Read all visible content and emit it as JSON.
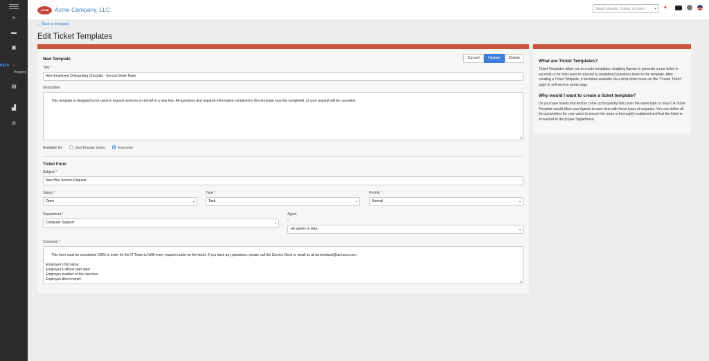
{
  "sidebar": {
    "items": [
      {
        "label": "Create",
        "icon": "plus-icon"
      },
      {
        "label": "Tickets",
        "icon": "ticket-icon"
      },
      {
        "label": "Assets",
        "icon": "assets-icon"
      },
      {
        "label": "BETA",
        "icon": ""
      },
      {
        "label": "Projects",
        "icon": "projects-icon"
      },
      {
        "label": "Knowledge Base",
        "icon": "book-icon"
      },
      {
        "label": "Reports",
        "icon": "reports-icon"
      },
      {
        "label": "Settings",
        "icon": "gear-icon"
      }
    ]
  },
  "header": {
    "logo_text": "ACME",
    "company": "Acme Company, LLC",
    "search_placeholder": "Search Assets, Tickets, or Users"
  },
  "page": {
    "back_link": "← Back to templates",
    "title": "Edit Ticket Templates"
  },
  "form": {
    "section_title": "New Template",
    "buttons": {
      "cancel": "Cancel",
      "update": "Update",
      "delete": "Delete"
    },
    "title_label": "Title",
    "title_value": "New Employee Onboarding Checklist - Service Desk Team",
    "description_label": "Description",
    "description_value": "This template is designed to be used to request services on behalf of a new hire. All questions and required information contained in this template must be completed, or your request will be canceled.",
    "available_label": "Available for:",
    "available_options": [
      "Just Regular Users",
      "Everyone"
    ],
    "available_selected": "Everyone",
    "ticket_form_title": "Ticket Form",
    "subject_label": "Subject",
    "subject_value": "New Hire Service Request",
    "status_label": "Status",
    "status_value": "Open",
    "type_label": "Type",
    "type_value": "Task",
    "priority_label": "Priority",
    "priority_value": "Normal",
    "department_label": "Department",
    "department_value": "Computer Support",
    "agent_label": "Agent",
    "agent_value": "-all agents in dept-",
    "comment_label": "Comment",
    "comment_value": "This form must be completed 100% in order for the IT Team to fulfill every request made on the ticket. If you have any questions, please call the Service Desk or email us at servicedesk@acmeco.com.\n\nEmployee's full name:\nEmployee's official start date:\nEmployee number of the new hire:\nEmployee direct report:",
    "required_mark": "*"
  },
  "help": {
    "q1": "What are Ticket Templates?",
    "a1": "Ticket Templates allow you to create templates, enabling Agents to generate a new ticket in seconds or for end-users to respond to predefined questions listed in the template. After creating a Ticket Template, it becomes available via a drop-down menu on the \"Create Ticket\" page or self-service portal page.",
    "q2": "Why would I want to create a ticket template?",
    "a2": "Do you have tickets that tend to come up frequently that cover the same topic or issue? A Ticket Template would allow your Agents to save time with these types of requests. You can define all the parameters for your users to ensure the issue is thoroughly explained and that the ticket is forwarded to the proper Department."
  },
  "colors": {
    "accent": "#c8533b",
    "primary": "#3b7dd8",
    "link": "#3a7cc2",
    "sidebar_bg": "#2b2b2b"
  }
}
